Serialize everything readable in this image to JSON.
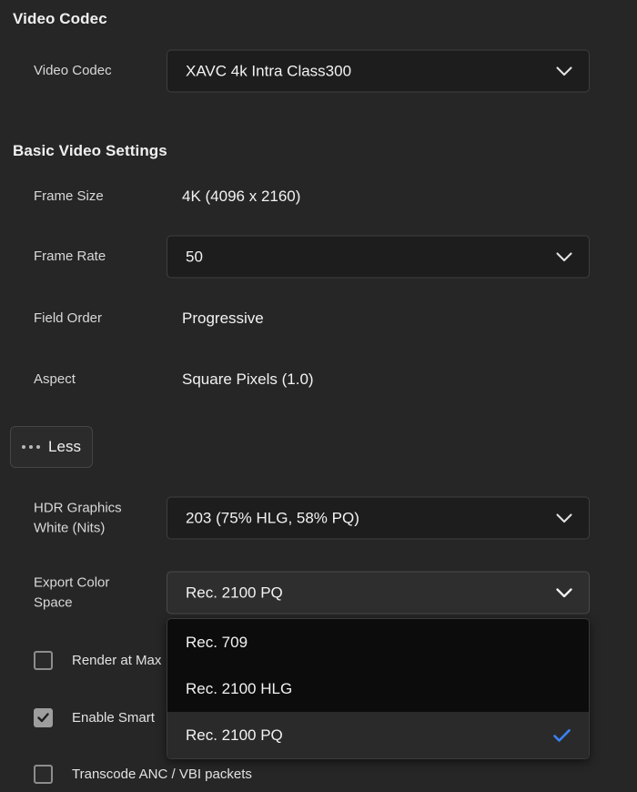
{
  "sections": {
    "video_codec": {
      "title": "Video Codec"
    },
    "basic_video": {
      "title": "Basic Video Settings"
    }
  },
  "rows": {
    "video_codec": {
      "label": "Video Codec",
      "value": "XAVC 4k Intra Class300",
      "icon": "chevron-down-icon"
    },
    "frame_size": {
      "label": "Frame Size",
      "value": "4K (4096 x 2160)"
    },
    "frame_rate": {
      "label": "Frame Rate",
      "value": "50",
      "icon": "chevron-down-icon"
    },
    "field_order": {
      "label": "Field Order",
      "value": "Progressive"
    },
    "aspect": {
      "label": "Aspect",
      "value": "Square Pixels (1.0)"
    },
    "hdr_graphics_white": {
      "label": "HDR Graphics\nWhite (Nits)",
      "value": "203 (75% HLG, 58% PQ)",
      "icon": "chevron-down-icon"
    },
    "export_color_space": {
      "label": "Export Color\nSpace",
      "value": "Rec. 2100 PQ",
      "icon": "chevron-down-icon"
    }
  },
  "less_button": {
    "label": "Less",
    "icon": "ellipsis-icon"
  },
  "checkboxes": [
    {
      "label": "Render at Max",
      "checked": false
    },
    {
      "label": "Enable Smart",
      "checked": true
    },
    {
      "label": "Transcode ANC / VBI packets",
      "checked": false
    }
  ],
  "dropdown": {
    "open": true,
    "selected": "Rec. 2100 PQ",
    "check_icon": "checkmark-icon",
    "options": [
      {
        "label": "Rec. 709",
        "selected": false
      },
      {
        "label": "Rec. 2100 HLG",
        "selected": false
      },
      {
        "label": "Rec. 2100 PQ",
        "selected": true
      }
    ]
  },
  "colors": {
    "background": "#262626",
    "field": "#1d1d1d",
    "field_active": "#2e2e2e",
    "menu_background": "#0c0c0c",
    "menu_selected": "#2a2a2a",
    "accent": "#3b82f6",
    "text": "#f2f2f2"
  }
}
